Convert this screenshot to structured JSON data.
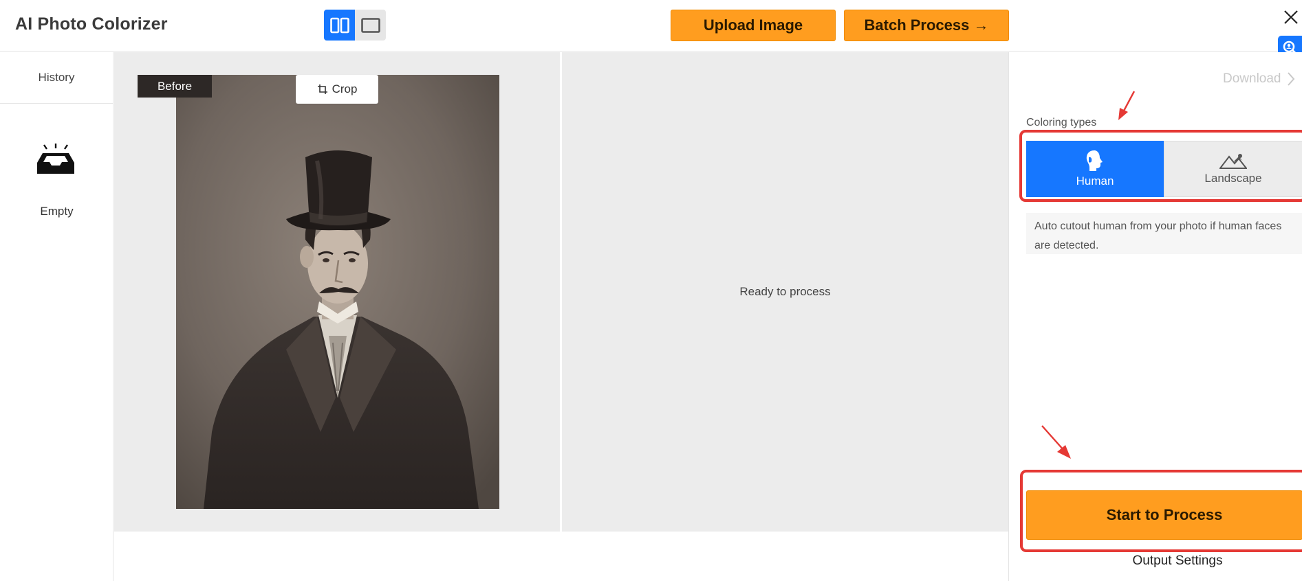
{
  "app": {
    "title": "AI Photo Colorizer"
  },
  "header": {
    "view_toggle": {
      "split_icon": "split-view-icon",
      "single_icon": "single-view-icon",
      "active": "split"
    },
    "upload_label": "Upload Image",
    "batch_label": "Batch Process →",
    "close_icon": "close-icon",
    "zoom_icon": "zoom-search-icon"
  },
  "sidebar": {
    "history_label": "History",
    "empty_icon": "empty-inbox-icon",
    "empty_label": "Empty"
  },
  "canvas": {
    "before_label": "Before",
    "crop_label": "Crop",
    "crop_icon": "crop-icon",
    "ready_text": "Ready to process"
  },
  "panel": {
    "download_label": "Download",
    "coloring_types_label": "Coloring types",
    "types": [
      {
        "label": "Human",
        "icon": "human-head-icon",
        "selected": true
      },
      {
        "label": "Landscape",
        "icon": "mountain-icon",
        "selected": false
      }
    ],
    "description": "Auto cutout human from your photo if human faces are detected.",
    "start_label": "Start to Process",
    "output_settings_label": "Output Settings"
  },
  "colors": {
    "accent_blue": "#1677ff",
    "button_orange": "#ff9d1f",
    "highlight_red": "#e53935",
    "canvas_gray": "#ececec"
  }
}
